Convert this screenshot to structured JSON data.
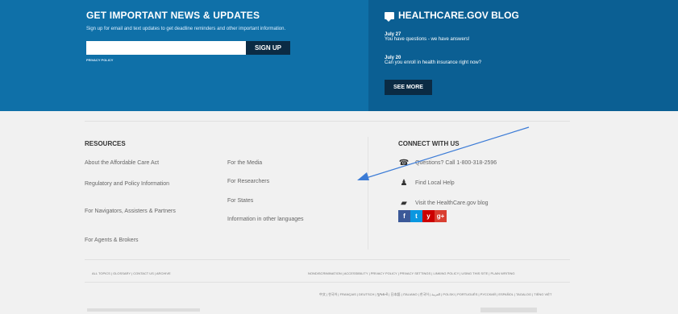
{
  "news": {
    "title": "GET IMPORTANT NEWS & UPDATES",
    "subtitle": "Sign up for email and text updates to get deadline reminders and other important information.",
    "signup_label": "SIGN UP",
    "privacy_label": "PRIVACY POLICY"
  },
  "blog": {
    "title": "HEALTHCARE.GOV BLOG",
    "posts": [
      {
        "date": "July 27",
        "text": "You have questions - we have answers!"
      },
      {
        "date": "July 20",
        "text": "Can you enroll in health insurance right now?"
      }
    ],
    "see_more": "SEE MORE"
  },
  "resources": {
    "title": "RESOURCES",
    "col1": [
      "About the Affordable Care Act",
      "Regulatory and Policy Information",
      "For Navigators, Assisters & Partners",
      "For Agents & Brokers"
    ],
    "col2": [
      "For the Media",
      "For Researchers",
      "For States",
      "Information in other languages"
    ]
  },
  "connect": {
    "title": "CONNECT WITH US",
    "items": [
      {
        "icon": "phone-icon",
        "label": "Questions? Call 1-800-318-2596"
      },
      {
        "icon": "local-help-icon",
        "label": "Find Local Help"
      },
      {
        "icon": "chat-icon",
        "label": "Visit the HealthCare.gov blog"
      }
    ],
    "social": [
      "f",
      "t",
      "y",
      "g+"
    ]
  },
  "footer": {
    "left_links": "ALL TOPICS | GLOSSARY | CONTACT US | ARCHIVE",
    "right_links": "NONDISCRIMINATION | ACCESSIBILITY | PRIVACY POLICY | PRIVACY SETTINGS | LINKING POLICY | USING THIS SITE | PLAIN WRITING",
    "languages": "中文 | 한국어 | FRANÇAIS | DEUTSCH | ગુજરાતી | 日本語 | ITALIANO | 한국어 | العربية | POLSKI | PORTUGUÊS | PУCCKИЙ | ESPAÑOL | TAGALOG | TIẾNG VIỆT"
  },
  "colors": {
    "primary": "#0f70a8",
    "secondary": "#0b5f93",
    "button": "#0b2b44",
    "annotation": "#3b7bd6"
  }
}
